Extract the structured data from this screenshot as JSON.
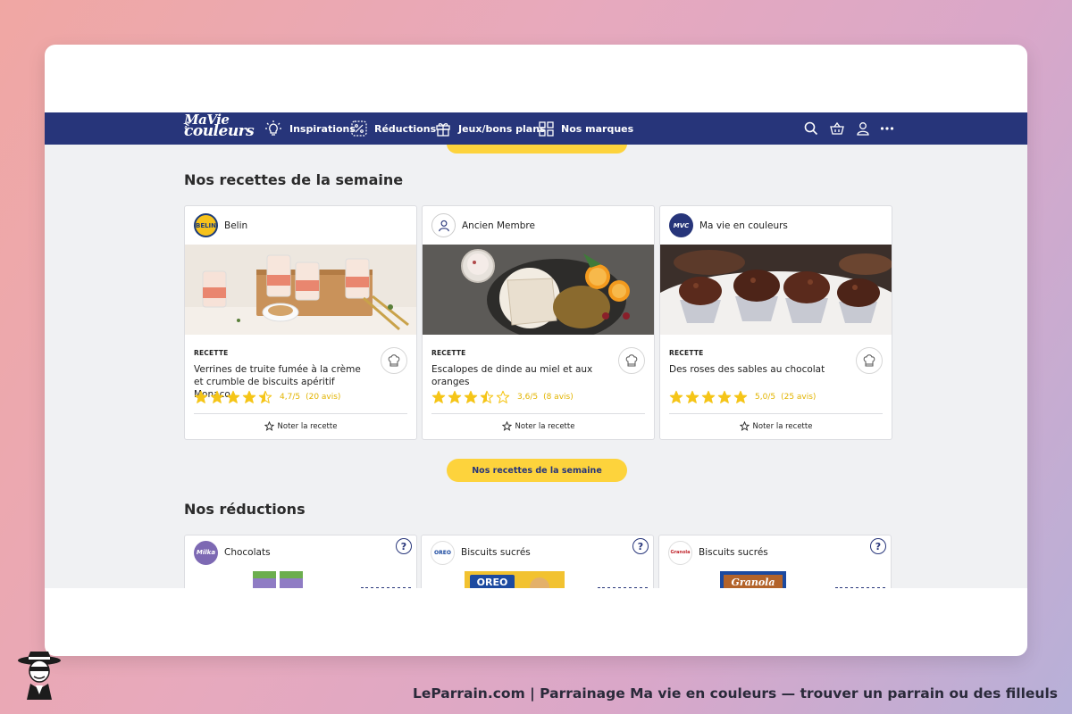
{
  "nav": {
    "logo_line1": "MaVie",
    "logo_line2": "couleurs",
    "logo_small": "en",
    "items": [
      {
        "label": "Inspirations",
        "icon": "lightbulb-icon"
      },
      {
        "label": "Réductions",
        "icon": "percent-icon"
      },
      {
        "label": "Jeux/bons plans",
        "icon": "gift-icon"
      },
      {
        "label": "Nos marques",
        "icon": "grid-icon"
      }
    ],
    "right_icons": [
      "search-icon",
      "basket-icon",
      "user-icon",
      "more-icon"
    ]
  },
  "recipes_section": {
    "title": "Nos recettes de la semaine",
    "cards": [
      {
        "author": "Belin",
        "avatar_text": "BELIN",
        "kind": "RECETTE",
        "title": "Verrines de truite fumée à la crème et crumble de biscuits apéritif Monaco...",
        "rating": 4.7,
        "rating_text": "4,7/5",
        "reviews": "(20 avis)",
        "rate_label": "Noter la recette"
      },
      {
        "author": "Ancien Membre",
        "avatar_text": "",
        "kind": "RECETTE",
        "title": "Escalopes de dinde au miel et aux oranges",
        "rating": 3.6,
        "rating_text": "3,6/5",
        "reviews": "(8 avis)",
        "rate_label": "Noter la recette"
      },
      {
        "author": "Ma vie en couleurs",
        "avatar_text": "MVC",
        "kind": "RECETTE",
        "title": "Des roses des sables au chocolat",
        "rating": 5.0,
        "rating_text": "5,0/5",
        "reviews": "(25 avis)",
        "rate_label": "Noter la recette"
      }
    ],
    "cta": "Nos recettes de la semaine"
  },
  "discounts_section": {
    "title": "Nos réductions",
    "cards": [
      {
        "category": "Chocolats",
        "brand": "Milka",
        "help": "?"
      },
      {
        "category": "Biscuits sucrés",
        "brand": "OREO",
        "product_label": "OREO",
        "help": "?"
      },
      {
        "category": "Biscuits sucrés",
        "brand": "Granola",
        "product_label": "Granola",
        "help": "?"
      }
    ]
  },
  "caption": "LeParrain.com | Parrainage Ma vie en couleurs — trouver un parrain ou des filleuls",
  "colors": {
    "navy": "#27357a",
    "yellow": "#fdd33c",
    "star": "#f5c518",
    "milka": "#7d69b3"
  }
}
